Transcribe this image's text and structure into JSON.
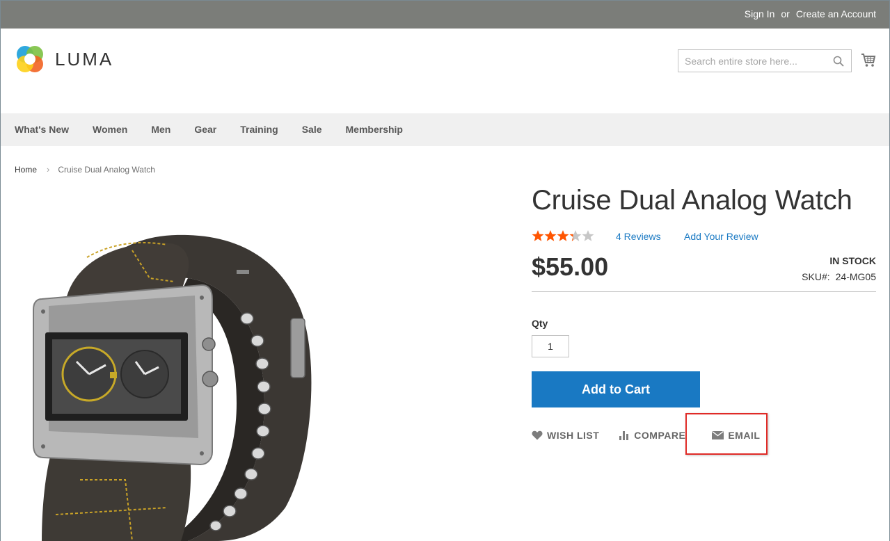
{
  "header": {
    "sign_in": "Sign In",
    "or": "or",
    "create_account": "Create an Account",
    "logo_text": "LUMA",
    "search_placeholder": "Search entire store here..."
  },
  "nav": {
    "items": [
      "What's New",
      "Women",
      "Men",
      "Gear",
      "Training",
      "Sale",
      "Membership"
    ]
  },
  "breadcrumb": {
    "home": "Home",
    "separator": "›",
    "current": "Cruise Dual Analog Watch"
  },
  "product": {
    "title": "Cruise Dual Analog Watch",
    "rating_stars": 3,
    "rating_max": 5,
    "reviews_link": "4 Reviews",
    "add_review": "Add Your Review",
    "price": "$55.00",
    "stock": "IN STOCK",
    "sku_label": "SKU#:",
    "sku_value": "24-MG05",
    "qty_label": "Qty",
    "qty_value": "1",
    "add_to_cart": "Add to Cart",
    "image_subject": "wristwatch with dark leather strap and dual analog dials"
  },
  "actions": {
    "wish_list": "WISH LIST",
    "compare": "COMPARE",
    "email": "EMAIL"
  },
  "colors": {
    "top_bar": "#7b7d79",
    "nav_bg": "#f0f0f0",
    "accent": "#1979c3",
    "star_filled": "#ff5501",
    "star_empty": "#c7c7c7",
    "highlight": "#e02b27"
  },
  "icons": {
    "search": "search-icon",
    "cart": "cart-icon",
    "heart": "heart-icon",
    "compare": "compare-icon",
    "email": "envelope-icon"
  }
}
